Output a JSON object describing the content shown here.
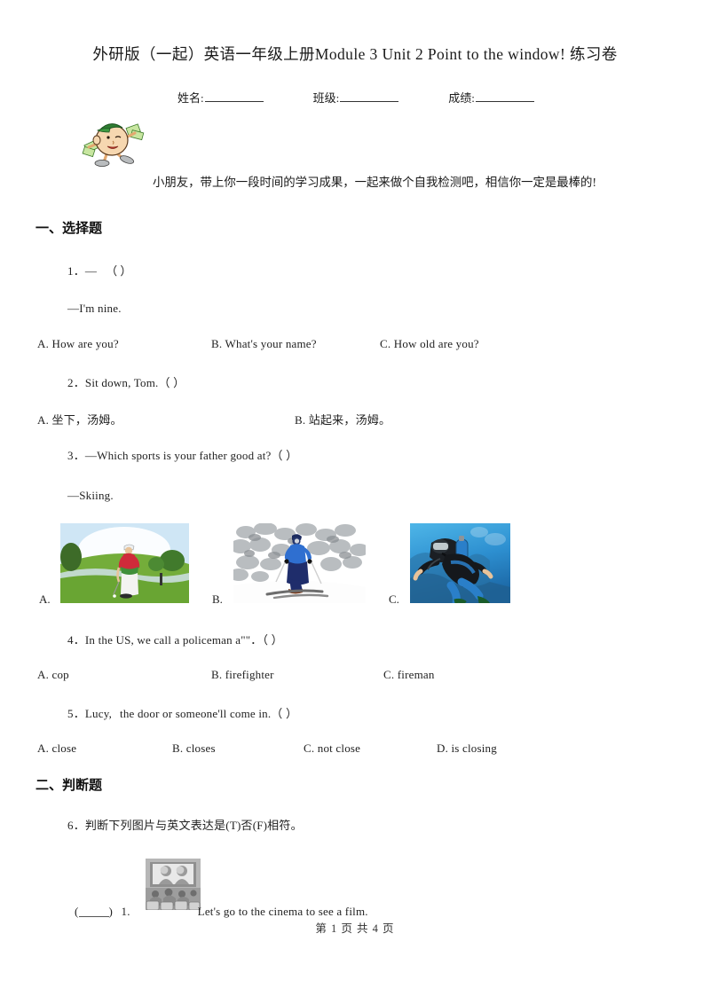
{
  "document": {
    "title": "外研版（一起）英语一年级上册Module 3 Unit 2 Point to the window! 练习卷",
    "footer": "第 1 页 共 4 页"
  },
  "info_line": {
    "name_label": "姓名:",
    "class_label": "班级:",
    "score_label": "成绩:"
  },
  "intro": {
    "mascot_icon": "cartoon-boy-with-money-icon",
    "text": "小朋友，带上你一段时间的学习成果，一起来做个自我检测吧，相信你一定是最棒的!"
  },
  "sections": [
    {
      "heading": "一、选择题",
      "questions": [
        {
          "number": "1",
          "stem": "1．—",
          "stem_tail": "（    ）",
          "sub": "—I'm nine.",
          "options": [
            "A. How are you?",
            "B. What's your name?",
            "C. How old are you?"
          ]
        },
        {
          "number": "2",
          "stem": "2．Sit down, Tom.（    ）",
          "options": [
            "A. 坐下，汤姆。",
            "B. 站起来，汤姆。"
          ]
        },
        {
          "number": "3",
          "stem": "3．—Which sports is your father good at?（    ）",
          "sub": "—Skiing.",
          "image_options": [
            {
              "label": "A.",
              "image": "golf-photo"
            },
            {
              "label": "B.",
              "image": "skiing-photo"
            },
            {
              "label": "C.",
              "image": "scuba-diving-photo"
            }
          ]
        },
        {
          "number": "4",
          "stem_pre": "4．In the US, we call a policeman a\"",
          "stem_post": "\"．（    ）",
          "options": [
            "A. cop",
            "B. firefighter",
            "C. fireman"
          ]
        },
        {
          "number": "5",
          "stem_pre": "5．Lucy,",
          "stem_post": "the door or someone'll come in.（    ）",
          "options": [
            "A. close",
            "B. closes",
            "C. not close",
            "D. is closing"
          ]
        }
      ]
    },
    {
      "heading": "二、判断题",
      "questions": [
        {
          "number": "6",
          "stem": "6．判断下列图片与英文表达是(T)否(F)相符。",
          "image": "cinema-audience-photo",
          "tf_item": {
            "index": "1.",
            "text": "Let's go to the cinema to see a film."
          }
        }
      ]
    }
  ]
}
